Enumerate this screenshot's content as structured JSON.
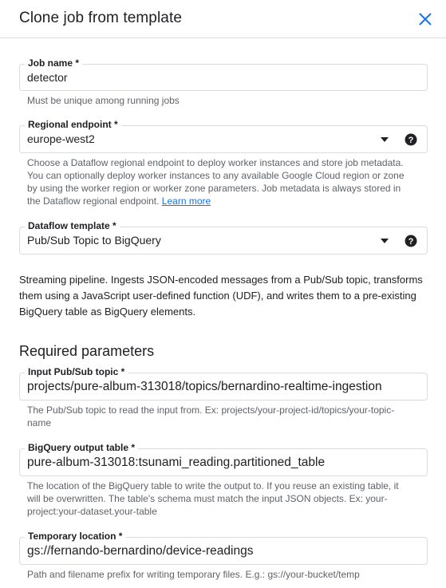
{
  "dialog": {
    "title": "Clone job from template",
    "close_icon": "close-icon"
  },
  "job_name": {
    "label": "Job name *",
    "value": "detector",
    "hint": "Must be unique among running jobs"
  },
  "regional_endpoint": {
    "label": "Regional endpoint *",
    "value": "europe-west2",
    "hint": "Choose a Dataflow regional endpoint to deploy worker instances and store job metadata. You can optionally deploy worker instances to any available Google Cloud region or zone by using the worker region or worker zone parameters. Job metadata is always stored in the Dataflow regional endpoint.",
    "learn_more": "Learn more"
  },
  "dataflow_template": {
    "label": "Dataflow template *",
    "value": "Pub/Sub Topic to BigQuery"
  },
  "template_description": "Streaming pipeline. Ingests JSON-encoded messages from a Pub/Sub topic, transforms them using a JavaScript user-defined function (UDF), and writes them to a pre-existing BigQuery table as BigQuery elements.",
  "required_parameters": {
    "title": "Required parameters",
    "input_topic": {
      "label": "Input Pub/Sub topic *",
      "value": "projects/pure-album-313018/topics/bernardino-realtime-ingestion",
      "hint": "The Pub/Sub topic to read the input from. Ex: projects/your-project-id/topics/your-topic-name"
    },
    "output_table": {
      "label": "BigQuery output table *",
      "value": "pure-album-313018:tsunami_reading.partitioned_table",
      "hint": "The location of the BigQuery table to write the output to. If you reuse an existing table, it will be overwritten. The table's schema must match the input JSON objects. Ex: your-project:your-dataset.your-table"
    },
    "temp_location": {
      "label": "Temporary location *",
      "value": "gs://fernando-bernardino/device-readings",
      "hint": "Path and filename prefix for writing temporary files. E.g.: gs://your-bucket/temp"
    }
  },
  "colors": {
    "accent": "#1a73e8",
    "border": "#dadce0",
    "hint_text": "#5f6368"
  }
}
